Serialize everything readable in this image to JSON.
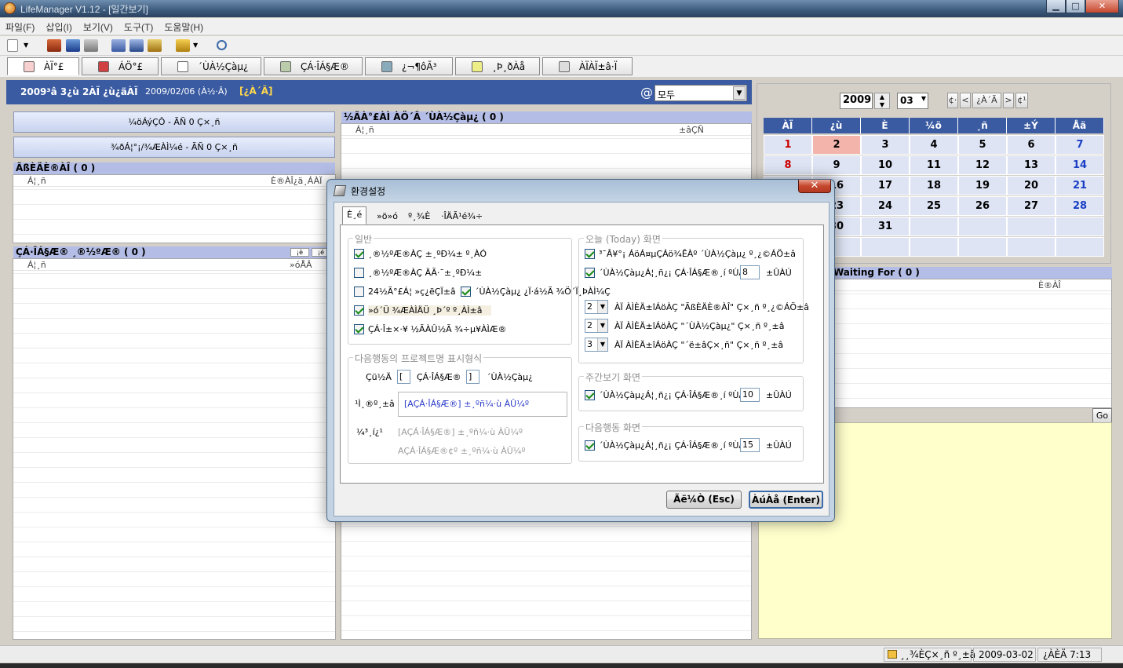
{
  "window": {
    "title": "LifeManager V1.12 - [일간보기]",
    "btn_min": "▁",
    "btn_max": "□",
    "btn_close": "✕"
  },
  "menu": [
    "파일(F)",
    "삽입(I)",
    "보기(V)",
    "도구(T)",
    "도움말(H)"
  ],
  "tabs": [
    "ÀÏ°£",
    "ÁÖ°£",
    "´ÙÀ½Çàµ¿",
    "ÇÁ·ÎÁ§Æ®",
    "¿¬¶ôÃ³",
    "¸Þ¸ðÀå",
    "ÀÏÀÏ±â·Ï"
  ],
  "datebar": {
    "date": "2009³â 3¿ù 2ÀÏ ¿ù¿äÀÏ",
    "week": "2009/02/06 (À½·Â)",
    "today": "[¿À´Ã]",
    "at": "@",
    "category": "모두"
  },
  "left": {
    "btn1": "¼öÁýÇÔ - ÃÑ 0 Ç×¸ñ",
    "btn2": "¾ðÁ¦°¡/¾ÆÀÌ¼­é - ÃÑ 0 Ç×¸ñ",
    "sec1": "ÃßÈÄÈ®ÀÎ ( 0 )",
    "sec1_col1": "Á¦¸ñ",
    "sec1_col2": "È®ÀÎ¿ä¸ÁÀÏ",
    "sec2": "ÇÁ·ÎÁ§Æ® ¸®½ºÆ® ( 0 )",
    "sec2_col1": "Á¦¸ñ",
    "sec2_col2": "»óÅÂ",
    "sec2_btn1": "¡è",
    "sec2_btn2": "¡é"
  },
  "middle": {
    "sec": "½ÃÀ°£ÀÌ ÀÖ´Â ´ÙÀ½Çàµ¿ ( 0 )",
    "col1": "Á¦¸ñ",
    "col2": "±âÇÑ"
  },
  "calendar": {
    "year": "2009",
    "month": "03",
    "nav": [
      "¢·",
      "<",
      "¿À´Ã",
      ">",
      "¢¹"
    ],
    "weekdays": [
      "ÀÏ",
      "¿ù",
      "È­",
      "¼ö",
      "¸ñ",
      "±Ý",
      "Åä"
    ],
    "weeks": [
      [
        "1",
        "2",
        "3",
        "4",
        "5",
        "6",
        "7"
      ],
      [
        "8",
        "9",
        "10",
        "11",
        "12",
        "13",
        "14"
      ],
      [
        "15",
        "16",
        "17",
        "18",
        "19",
        "20",
        "21"
      ],
      [
        "22",
        "23",
        "24",
        "25",
        "26",
        "27",
        "28"
      ],
      [
        "29",
        "30",
        "31",
        "",
        "",
        "",
        ""
      ],
      [
        "",
        "",
        "",
        "",
        "",
        "",
        ""
      ]
    ],
    "today": "2",
    "sunday_color": "#cc0000",
    "saturday_color": "#1a3fc4"
  },
  "waiting": {
    "title": "Waiting For ( 0 )",
    "col": "È®ÀÎ",
    "go": "Go"
  },
  "status": {
    "lock": "¸¸¾ÈÇ×¸ñ º¸±â",
    "date": "2009-03-02",
    "time": "¿ÀÈÄ 7:13"
  },
  "dialog": {
    "title": "환경설정",
    "close": "✕",
    "tabs": [
      "È­¸é",
      "»ö»ó",
      "º¸¾È",
      "·ÎÄÃ¹é¾÷"
    ],
    "group_general": {
      "title": "일반",
      "items": [
        {
          "label": "¸®½ºÆ®ÀÇ ±¸ºÐ¼± º¸ÀÓ",
          "checked": true
        },
        {
          "label": "¸®½ºÆ®ÀÇ ÄÃ·¯±¸ºÐ¼±",
          "checked": false
        },
        {
          "label": "24½Ã°£Á¦ »ç¿ëÇÏ±â",
          "checked": false
        },
        {
          "label": "´ÙÀ½Çàµ¿ ¿Ï·á½Ã ¾Ö´Ï¸ÞÀÌ¼Ç",
          "checked": true
        },
        {
          "label": "»ó´Ü ¾ÆÀÌÄÜ ¸Þ´º º¸ÀÌ±â",
          "checked": true
        },
        {
          "label": "ÇÁ·Î±×·¥ ½ÃÀÛ½Ã ¾÷µ¥ÀÌÆ®",
          "checked": true
        }
      ],
      "item3b": "ÀÏ·Â³¯Â¥ º¸¿©ÁÖ±â"
    },
    "group_format": {
      "title": "다음행동의 프로젝트명 표시형식",
      "prefix_label": "Çü½Ä",
      "open": "[",
      "mid": "ÇÁ·ÎÁ§Æ®",
      "close": "]",
      "suffix": "´ÙÀ½Çàµ¿",
      "preview_label": "¹Ì¸®º¸±â",
      "preview": "[AÇÁ·ÎÁ§Æ®] ±¸ºñ¼­·ù ÀÛ¼º",
      "ex_label": "¼³¸í¿¹",
      "ex1": "[AÇÁ·ÎÁ§Æ®] ±¸ºñ¼­·ù ÀÛ¼º",
      "ex2": "AÇÁ·ÎÁ§Æ®¢º ±¸ºñ¼­·ù ÀÛ¼º"
    },
    "group_today": {
      "title": "오늘 (Today) 화면",
      "chk1": "³¯Â¥°¡ ÁöÁ¤µÇÁö¾ÊÀº ´ÙÀ½Çàµ¿ º¸¿©ÁÖ±â",
      "chk2": "´ÙÀ½Çàµ¿Á¦¸ñ¿¡ ÇÁ·ÎÁ§Æ®¸í ºÙÀÌ±â",
      "chk2_val": "8",
      "unit": "±ÛÀÚ",
      "sel1": "2",
      "sel1_label": "ÀÏ ÀÌÈÄ±îÁöÀÇ \"ÃßÈÄÈ®ÀÎ\" Ç×¸ñ º¸¿©ÁÖ±â",
      "sel2": "2",
      "sel2_label": "ÀÏ ÀÌÈÄ±îÁöÀÇ \"´ÙÀ½Çàµ¿\" Ç×¸ñ º¸±â",
      "sel3": "3",
      "sel3_label": "ÀÏ ÀÌÈÄ±îÁöÀÇ \"´ë±âÇ×¸ñ\" Ç×¸ñ º¸±â"
    },
    "group_week": {
      "title": "주간보기 화면",
      "chk": "´ÙÀ½Çàµ¿Á¦¸ñ¿¡ ÇÁ·ÎÁ§Æ®¸í ºÙÀÌ±â",
      "val": "10",
      "unit": "±ÛÀÚ"
    },
    "group_next": {
      "title": "다음행동 화면",
      "chk": "´ÙÀ½Çàµ¿Á¦¸ñ¿¡ ÇÁ·ÎÁ§Æ®¸í ºÙÀÌ±â",
      "val": "15",
      "unit": "±ÛÀÚ"
    },
    "cancel": "Ãë¼Ò (Esc)",
    "ok": "ÀúÀå (Enter)"
  }
}
